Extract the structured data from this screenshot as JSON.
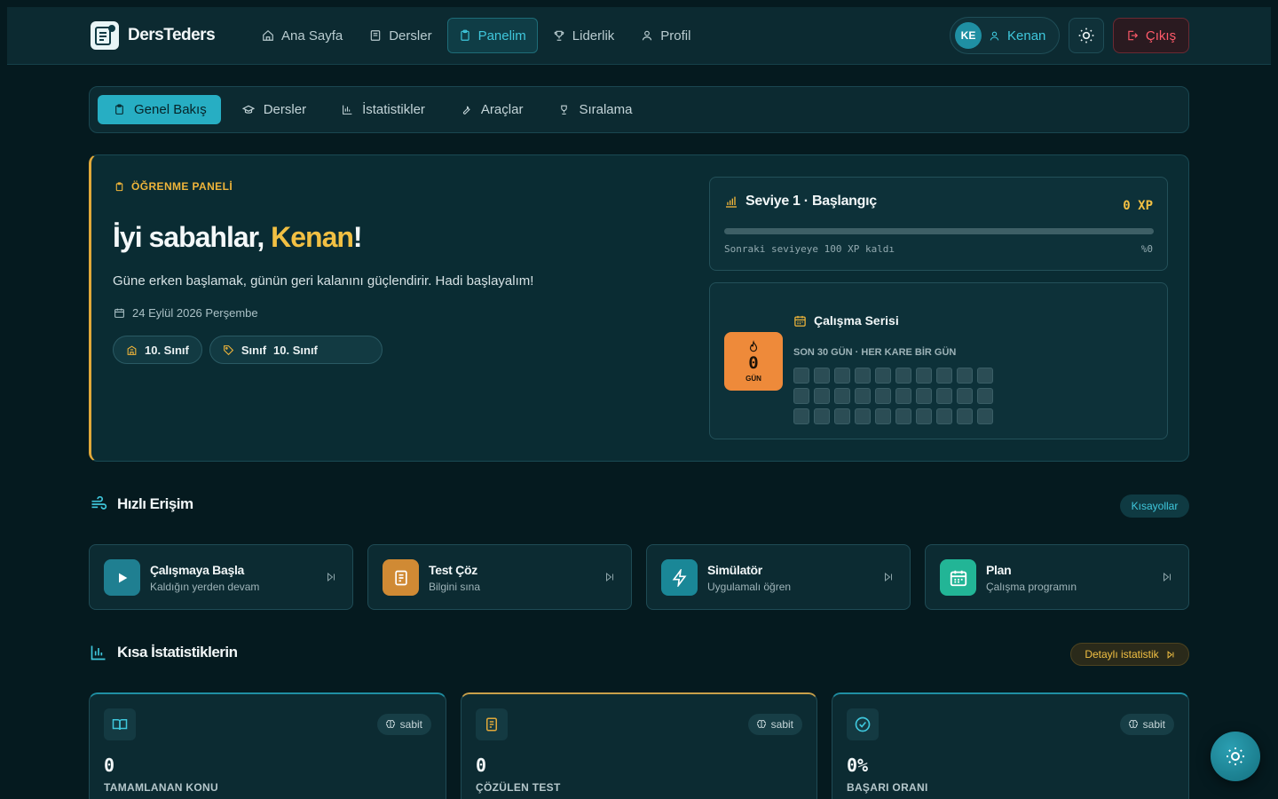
{
  "brand": {
    "name": "DersTeders"
  },
  "nav": {
    "items": [
      {
        "label": "Ana Sayfa",
        "icon": "home-icon"
      },
      {
        "label": "Dersler",
        "icon": "book-icon"
      },
      {
        "label": "Panelim",
        "icon": "clipboard-icon",
        "active": true
      },
      {
        "label": "Liderlik",
        "icon": "trophy-icon"
      },
      {
        "label": "Profil",
        "icon": "user-icon"
      }
    ],
    "user": {
      "initials": "KE",
      "name": "Kenan"
    },
    "logout_label": "Çıkış"
  },
  "tabs": [
    {
      "label": "Genel Bakış",
      "active": true
    },
    {
      "label": "Dersler"
    },
    {
      "label": "İstatistikler"
    },
    {
      "label": "Araçlar"
    },
    {
      "label": "Sıralama"
    }
  ],
  "hero": {
    "eyebrow": "ÖĞRENME PANELİ",
    "greeting_prefix": "İyi sabahlar, ",
    "greeting_name": "Kenan",
    "greeting_suffix": "!",
    "subtitle": "Güne erken başlamak, günün geri kalanını güçlendirir. Hadi başlayalım!",
    "date": "24 Eylül 2026 Perşembe",
    "chip_grade": "10. Sınıf",
    "chip_class_label": "Sınıf",
    "chip_class_value": "10. Sınıf"
  },
  "level": {
    "title": "Seviye 1 · Başlangıç",
    "xp": "0 XP",
    "note": "Sonraki seviyeye 100 XP kaldı",
    "percent_label": "%0",
    "progress": 0
  },
  "streak": {
    "count": "0",
    "unit": "GÜN",
    "title": "Çalışma Serisi",
    "subtitle": "SON 30 GÜN · HER KARE BİR GÜN",
    "days_active": 0
  },
  "quick": {
    "title": "Hızlı Erişim",
    "shortcuts_label": "Kısayollar",
    "items": [
      {
        "title": "Çalışmaya Başla",
        "subtitle": "Kaldığın yerden devam",
        "color": "#1f7f91",
        "icon": "play-icon"
      },
      {
        "title": "Test Çöz",
        "subtitle": "Bilgini sına",
        "color": "#d08a34",
        "icon": "test-icon"
      },
      {
        "title": "Simülatör",
        "subtitle": "Uygulamalı öğren",
        "color": "#1a8797",
        "icon": "bolt-icon"
      },
      {
        "title": "Plan",
        "subtitle": "Çalışma programın",
        "color": "#22b596",
        "icon": "calendar-icon"
      }
    ]
  },
  "stats": {
    "title": "Kısa İstatistiklerin",
    "detail_label": "Detaylı istatistik",
    "cards": [
      {
        "value": "0",
        "label": "TAMAMLANAN KONU",
        "badge": "sabit",
        "accent": "#1f8fa3"
      },
      {
        "value": "0",
        "label": "ÇÖZÜLEN TEST",
        "badge": "sabit",
        "accent": "#c9a04a"
      },
      {
        "value": "0%",
        "label": "BAŞARI ORANI",
        "badge": "sabit",
        "accent": "#1f8fa3"
      }
    ]
  }
}
